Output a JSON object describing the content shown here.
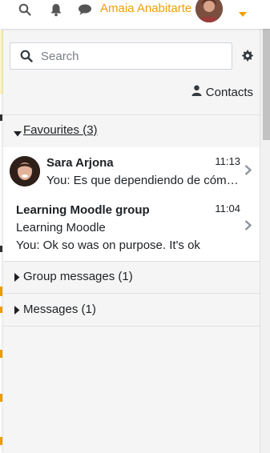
{
  "navbar": {
    "user_name": "Amaia Anabitarte",
    "icons": [
      "search-icon",
      "bell-icon",
      "chat-icon",
      "caret-down-icon"
    ],
    "accent_color": "#f0a000"
  },
  "drawer": {
    "search": {
      "placeholder": "Search",
      "value": ""
    },
    "contacts_label": "Contacts",
    "favourites": {
      "label": "Favourites (3)",
      "expanded": true,
      "conversations": [
        {
          "name": "Sara Arjona",
          "time": "11:13",
          "preview": "You: Es que dependiendo de cóm…"
        },
        {
          "name": "Learning Moodle group",
          "time": "11:04",
          "subtitle": "Learning Moodle",
          "preview": "You: Ok so was on purpose. It's ok"
        }
      ]
    },
    "group_messages_label": "Group messages (1)",
    "messages_label": "Messages (1)"
  }
}
